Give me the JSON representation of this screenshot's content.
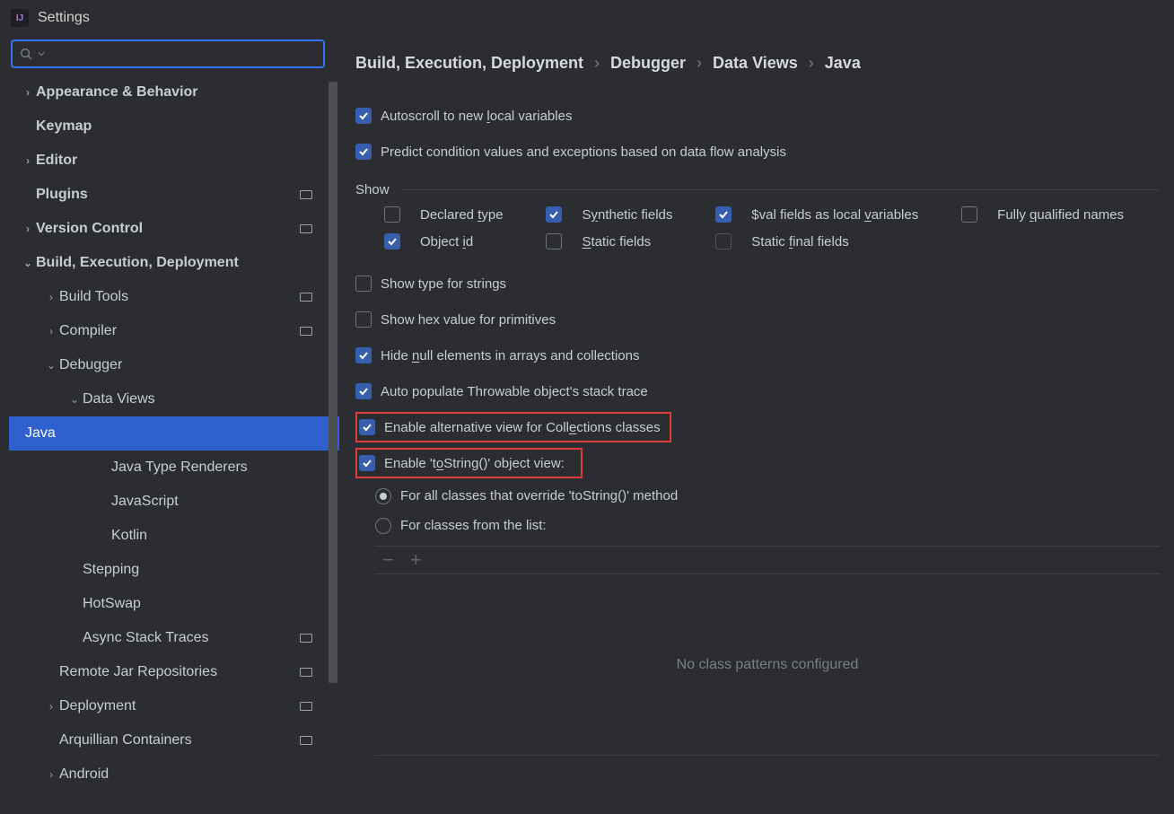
{
  "window": {
    "title": "Settings"
  },
  "breadcrumb": {
    "a": "Build, Execution, Deployment",
    "b": "Debugger",
    "c": "Data Views",
    "d": "Java"
  },
  "sidebar": {
    "items": [
      {
        "label": "Appearance & Behavior"
      },
      {
        "label": "Keymap"
      },
      {
        "label": "Editor"
      },
      {
        "label": "Plugins"
      },
      {
        "label": "Version Control"
      },
      {
        "label": "Build, Execution, Deployment"
      },
      {
        "label": "Build Tools"
      },
      {
        "label": "Compiler"
      },
      {
        "label": "Debugger"
      },
      {
        "label": "Data Views"
      },
      {
        "label": "Java"
      },
      {
        "label": "Java Type Renderers"
      },
      {
        "label": "JavaScript"
      },
      {
        "label": "Kotlin"
      },
      {
        "label": "Stepping"
      },
      {
        "label": "HotSwap"
      },
      {
        "label": "Async Stack Traces"
      },
      {
        "label": "Remote Jar Repositories"
      },
      {
        "label": "Deployment"
      },
      {
        "label": "Arquillian Containers"
      },
      {
        "label": "Android"
      }
    ]
  },
  "top": {
    "autoscroll_pre": "Autoscroll to new ",
    "autoscroll_u": "l",
    "autoscroll_post": "ocal variables",
    "predict": "Predict condition values and exceptions based on data flow analysis"
  },
  "show": {
    "title": "Show",
    "declared_pre": "Declared ",
    "declared_u": "t",
    "declared_post": "ype",
    "synth_pre": "S",
    "synth_u": "y",
    "synth_post": "nthetic fields",
    "val_pre": "$val fields as local ",
    "val_u": "v",
    "val_post": "ariables",
    "fq_pre": "Fully ",
    "fq_u": "q",
    "fq_post": "ualified names",
    "obj_pre": "Object ",
    "obj_u": "i",
    "obj_post": "d",
    "static_u": "S",
    "static_post": "tatic fields",
    "sfinal_pre": "Static ",
    "sfinal_u": "f",
    "sfinal_post": "inal fields"
  },
  "opts": {
    "show_type_strings": "Show type for strings",
    "show_hex": "Show hex value for primitives",
    "hide_null_pre": "Hide ",
    "hide_null_u": "n",
    "hide_null_post": "ull elements in arrays and collections",
    "auto_throwable": "Auto populate Throwable object's stack trace",
    "alt_pre": "Enable alternative view for Coll",
    "alt_u": "e",
    "alt_post": "ctions classes",
    "tostring_pre": "Enable 't",
    "tostring_u": "o",
    "tostring_post": "String()' object view:",
    "radio1": "For all classes that override 'toString()' method",
    "radio2": "For classes from the list:",
    "empty": "No class patterns configured"
  }
}
